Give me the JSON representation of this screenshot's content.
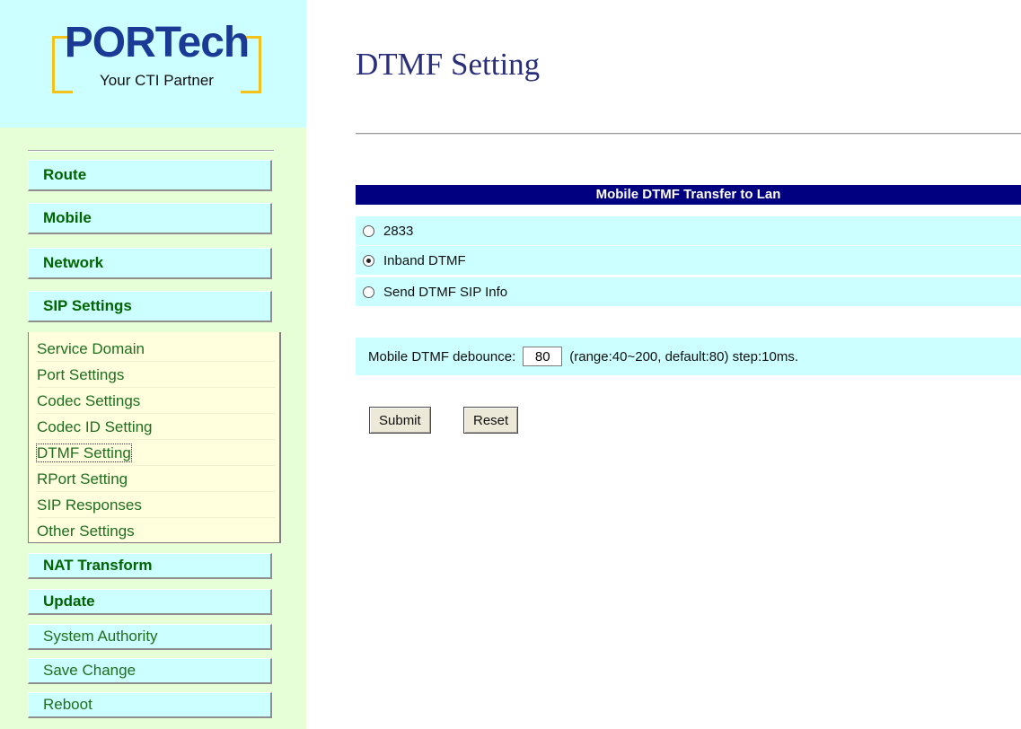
{
  "logo": {
    "brand": "PORTech",
    "tagline": "Your CTI Partner"
  },
  "colors": {
    "sidebar_bg": "#e6ffd7",
    "logo_bg": "#ccffff",
    "menu_btn_bg": "#ccffff",
    "submenu_bg": "#ffffdd",
    "menu_text": "#006400",
    "header_bg": "#000080",
    "title_color": "#2a2f7a",
    "row_bg": "#ccffff"
  },
  "menu": {
    "route": "Route",
    "mobile": "Mobile",
    "network": "Network",
    "sip_settings": "SIP Settings",
    "nat_transform": "NAT Transform",
    "update": "Update",
    "system_authority": "System Authority",
    "save_change": "Save Change",
    "reboot": "Reboot"
  },
  "submenu": [
    "Service Domain",
    "Port Settings",
    "Codec Settings",
    "Codec ID Setting",
    "DTMF Setting",
    "RPort Setting",
    "SIP Responses",
    "Other Settings"
  ],
  "main": {
    "title": "DTMF Setting",
    "section_header": "Mobile DTMF Transfer to Lan",
    "options": [
      {
        "label": "2833",
        "checked": false
      },
      {
        "label": "Inband DTMF",
        "checked": true
      },
      {
        "label": "Send DTMF SIP Info",
        "checked": false
      }
    ],
    "debounce_label": "Mobile DTMF debounce:",
    "debounce_value": "80",
    "debounce_hint": "(range:40~200, default:80) step:10ms.",
    "submit_label": "Submit",
    "reset_label": "Reset"
  }
}
